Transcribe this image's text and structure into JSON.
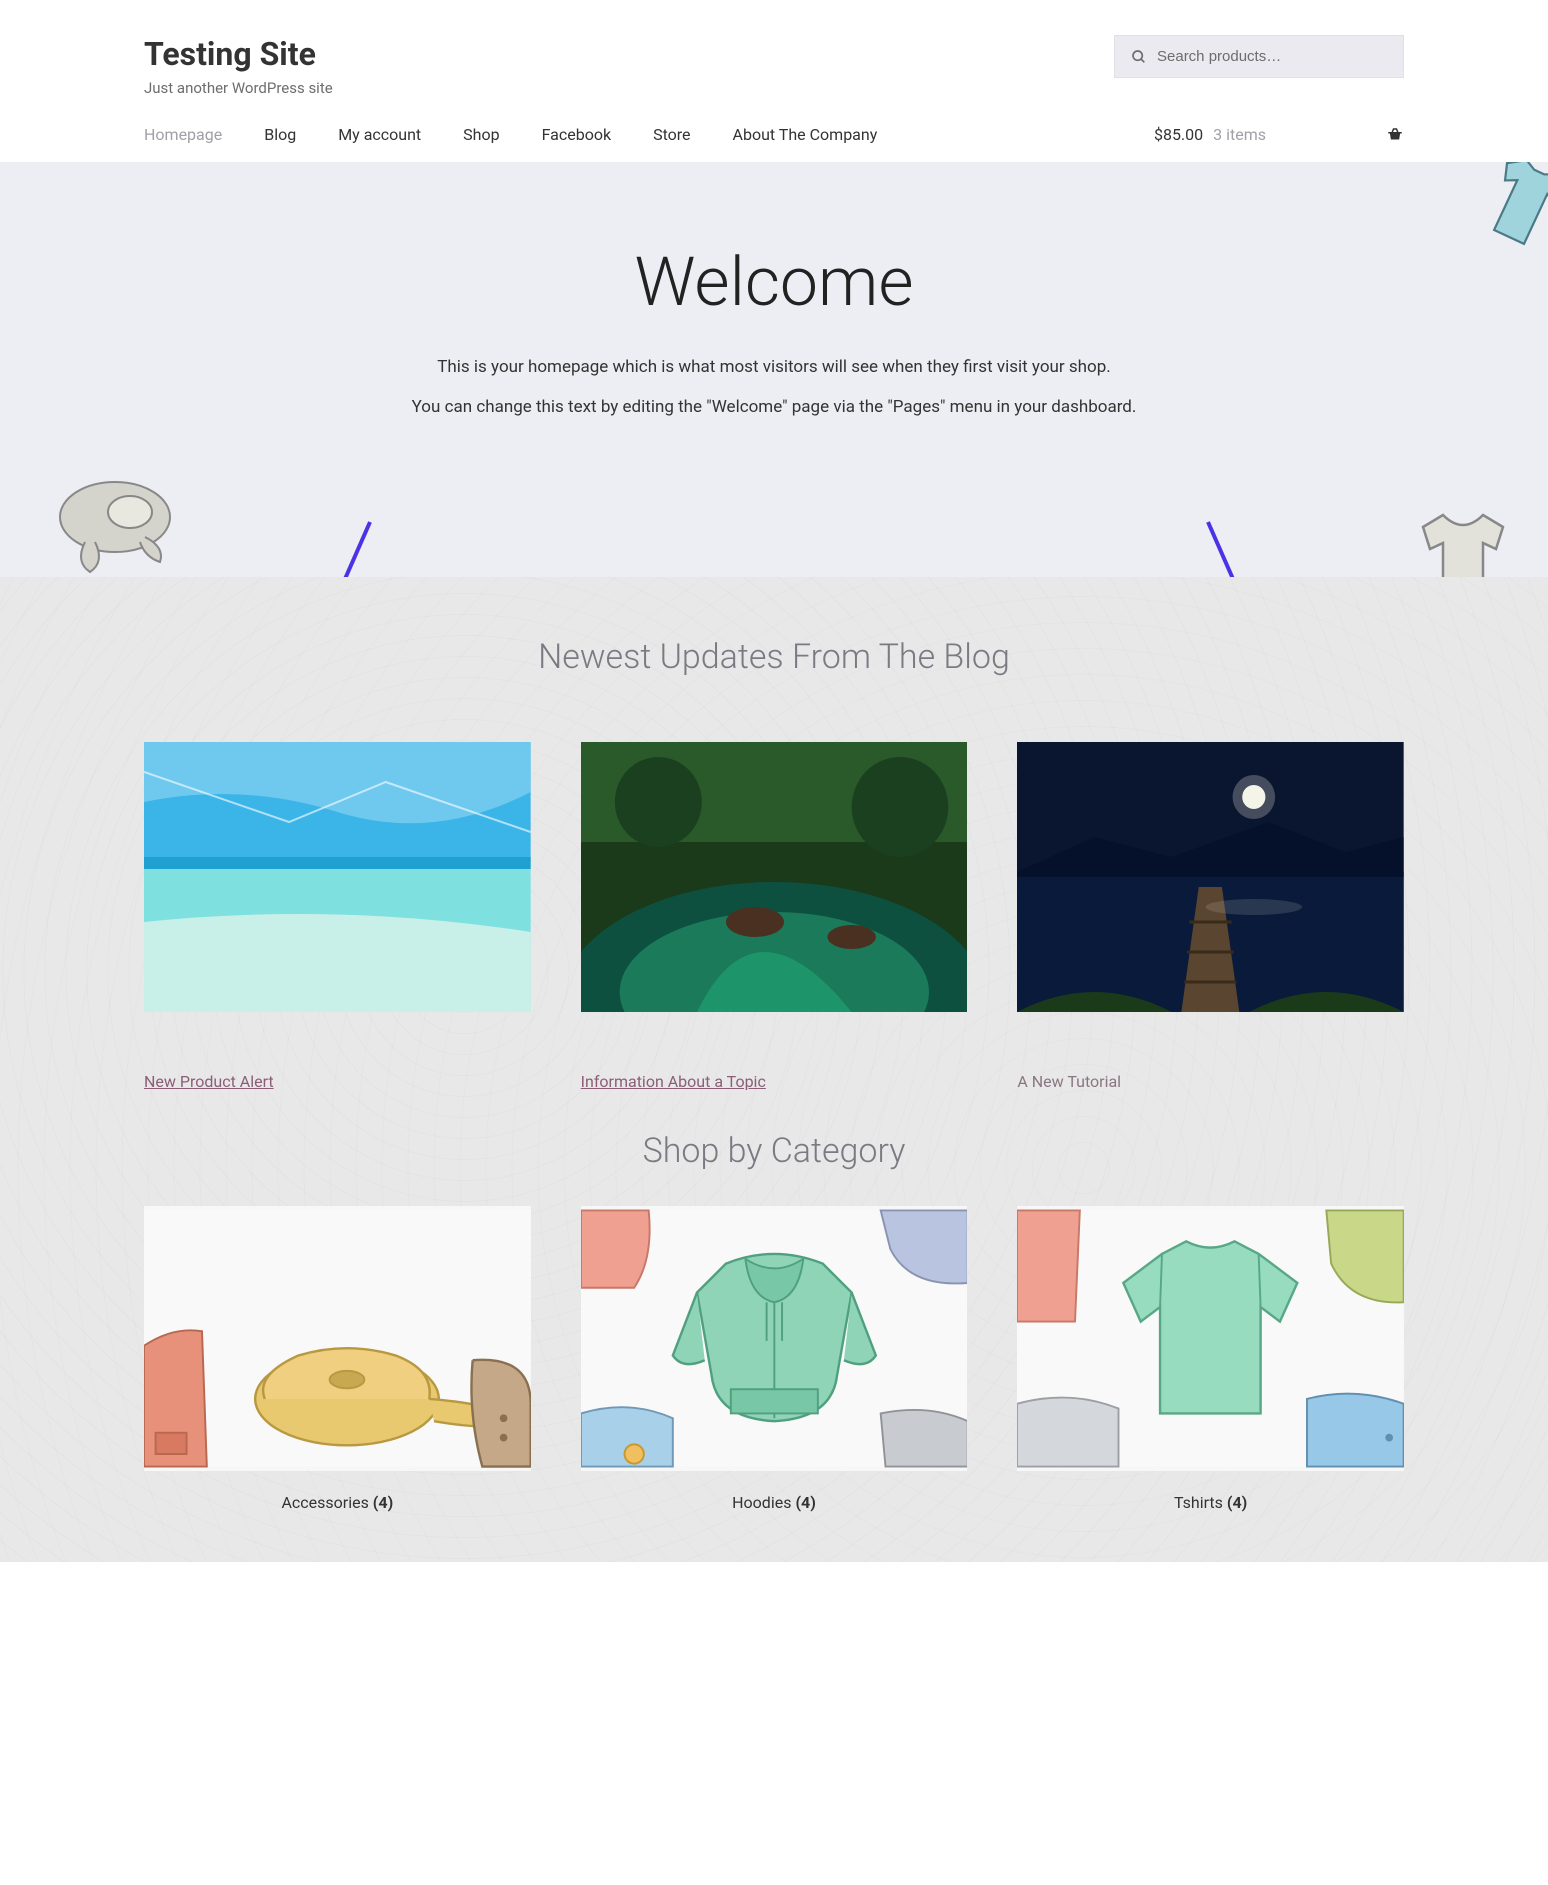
{
  "header": {
    "site_title": "Testing Site",
    "tagline": "Just another WordPress site",
    "search_placeholder": "Search products…"
  },
  "nav": {
    "items": [
      {
        "label": "Homepage",
        "active": true
      },
      {
        "label": "Blog",
        "active": false
      },
      {
        "label": "My account",
        "active": false
      },
      {
        "label": "Shop",
        "active": false
      },
      {
        "label": "Facebook",
        "active": false
      },
      {
        "label": "Store",
        "active": false
      },
      {
        "label": "About The Company",
        "active": false
      }
    ]
  },
  "cart": {
    "total": "$85.00",
    "items_text": "3 items"
  },
  "hero": {
    "title": "Welcome",
    "line1": "This is your homepage which is what most visitors will see when they first visit your shop.",
    "line2": "You can change this text by editing the \"Welcome\" page via the \"Pages\" menu in your dashboard."
  },
  "blog_section": {
    "title": "Newest Updates From The Blog",
    "posts": [
      {
        "title": "New Product Alert"
      },
      {
        "title": "Information About a Topic"
      },
      {
        "title": "A New Tutorial"
      }
    ]
  },
  "category_section": {
    "title": "Shop by Category",
    "cats": [
      {
        "name": "Accessories",
        "count": "(4)"
      },
      {
        "name": "Hoodies",
        "count": "(4)"
      },
      {
        "name": "Tshirts",
        "count": "(4)"
      }
    ]
  }
}
